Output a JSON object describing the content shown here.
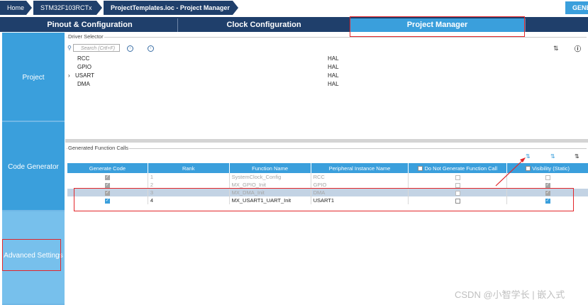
{
  "breadcrumb": [
    "Home",
    "STM32F103RCTx",
    "ProjectTemplates.ioc - Project Manager"
  ],
  "generate_button": "GENE",
  "tabs": [
    "Pinout & Configuration",
    "Clock Configuration",
    "Project Manager"
  ],
  "active_tab": "Project Manager",
  "sidebar": [
    "Project",
    "Code Generator",
    "Advanced Settings"
  ],
  "active_sidebar": "Advanced Settings",
  "driver_selector": {
    "title": "Driver Selector",
    "search_placeholder": "Search (Crtl+F)",
    "rows": [
      {
        "name": "RCC",
        "driver": "HAL",
        "expandable": false
      },
      {
        "name": "GPIO",
        "driver": "HAL",
        "expandable": false
      },
      {
        "name": "USART",
        "driver": "HAL",
        "expandable": true
      },
      {
        "name": "DMA",
        "driver": "HAL",
        "expandable": false
      }
    ]
  },
  "function_calls": {
    "title": "Generated Function Calls",
    "headers": [
      "Generate Code",
      "Rank",
      "Function Name",
      "Peripheral Instance Name",
      "Do Not Generate Function Call",
      "Visibility (Static)"
    ],
    "rows": [
      {
        "generate": true,
        "rank": "1",
        "function": "SystemClock_Config",
        "instance": "RCC",
        "no_generate": false,
        "visibility": false,
        "state": "disabled"
      },
      {
        "generate": true,
        "rank": "2",
        "function": "MX_GPIO_Init",
        "instance": "GPIO",
        "no_generate": false,
        "visibility": true,
        "state": "disabled"
      },
      {
        "generate": true,
        "rank": "3",
        "function": "MX_DMA_Init",
        "instance": "DMA",
        "no_generate": false,
        "visibility": true,
        "state": "selected"
      },
      {
        "generate": true,
        "rank": "4",
        "function": "MX_USART1_UART_Init",
        "instance": "USART1",
        "no_generate": false,
        "visibility": true,
        "state": "normal"
      }
    ]
  },
  "watermark": "CSDN @小智学长 | 嵌入式",
  "icons": {
    "sort_desc": "sort-descending-icon",
    "sort_asc": "sort-ascending-icon",
    "sort_az": "sort-alpha-icon",
    "info": "info-icon",
    "search": "search-icon"
  },
  "colors": {
    "nav_dark": "#1f3f6b",
    "accent": "#3a9fdc",
    "annotation": "#e3262a"
  }
}
